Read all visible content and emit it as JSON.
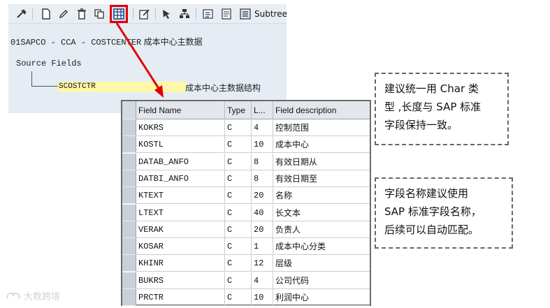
{
  "toolbar": {
    "icons": [
      "tool-icon",
      "new-document-icon",
      "edit-pencil-icon",
      "delete-trash-icon",
      "copy-icon",
      "table-grid-icon",
      "edit-form-icon",
      "pointer-select-icon",
      "hierarchy-icon",
      "insert-subtree-icon",
      "checklist-icon",
      "subtree-icon"
    ],
    "subtree_label": "Subtree",
    "active_icon": "table-grid-icon"
  },
  "breadcrumb": {
    "code": "01SAPCO - CCA - COSTCENTER",
    "title": "成本中心主数据"
  },
  "tree": {
    "root_label": "Source Fields",
    "structure_name": "SCOSTCTR",
    "structure_desc": "成本中心主数据结构"
  },
  "table": {
    "headers": {
      "field_name": "Field Name",
      "type": "Type",
      "length": "L...",
      "description": "Field description"
    },
    "rows": [
      {
        "name": "KOKRS",
        "type": "C",
        "len": "4",
        "desc": "控制范围"
      },
      {
        "name": "KOSTL",
        "type": "C",
        "len": "10",
        "desc": "成本中心"
      },
      {
        "name": "DATAB_ANFO",
        "type": "C",
        "len": "8",
        "desc": "有效日期从"
      },
      {
        "name": "DATBI_ANFO",
        "type": "C",
        "len": "8",
        "desc": "有效日期至"
      },
      {
        "name": "KTEXT",
        "type": "C",
        "len": "20",
        "desc": "名称"
      },
      {
        "name": "LTEXT",
        "type": "C",
        "len": "40",
        "desc": "长文本"
      },
      {
        "name": "VERAK",
        "type": "C",
        "len": "20",
        "desc": "负责人"
      },
      {
        "name": "KOSAR",
        "type": "C",
        "len": "1",
        "desc": "成本中心分类"
      },
      {
        "name": "KHINR",
        "type": "C",
        "len": "12",
        "desc": "层级"
      },
      {
        "name": "BUKRS",
        "type": "C",
        "len": "4",
        "desc": "公司代码"
      },
      {
        "name": "PRCTR",
        "type": "C",
        "len": "10",
        "desc": "利润中心"
      }
    ]
  },
  "notes": {
    "note1": {
      "line1": "建议统一用 Char 类",
      "line2": "型 ,长度与 SAP 标准",
      "line3": "字段保持一致。"
    },
    "note2": {
      "line1": "字段名称建议使用",
      "line2": "SAP 标准字段名称，",
      "line3": "后续可以自动匹配。"
    }
  },
  "watermark": "大数跨境",
  "colors": {
    "highlight_red": "#e00000",
    "struct_highlight": "#fdf8a8",
    "panel_bg": "#e6ecf3"
  }
}
